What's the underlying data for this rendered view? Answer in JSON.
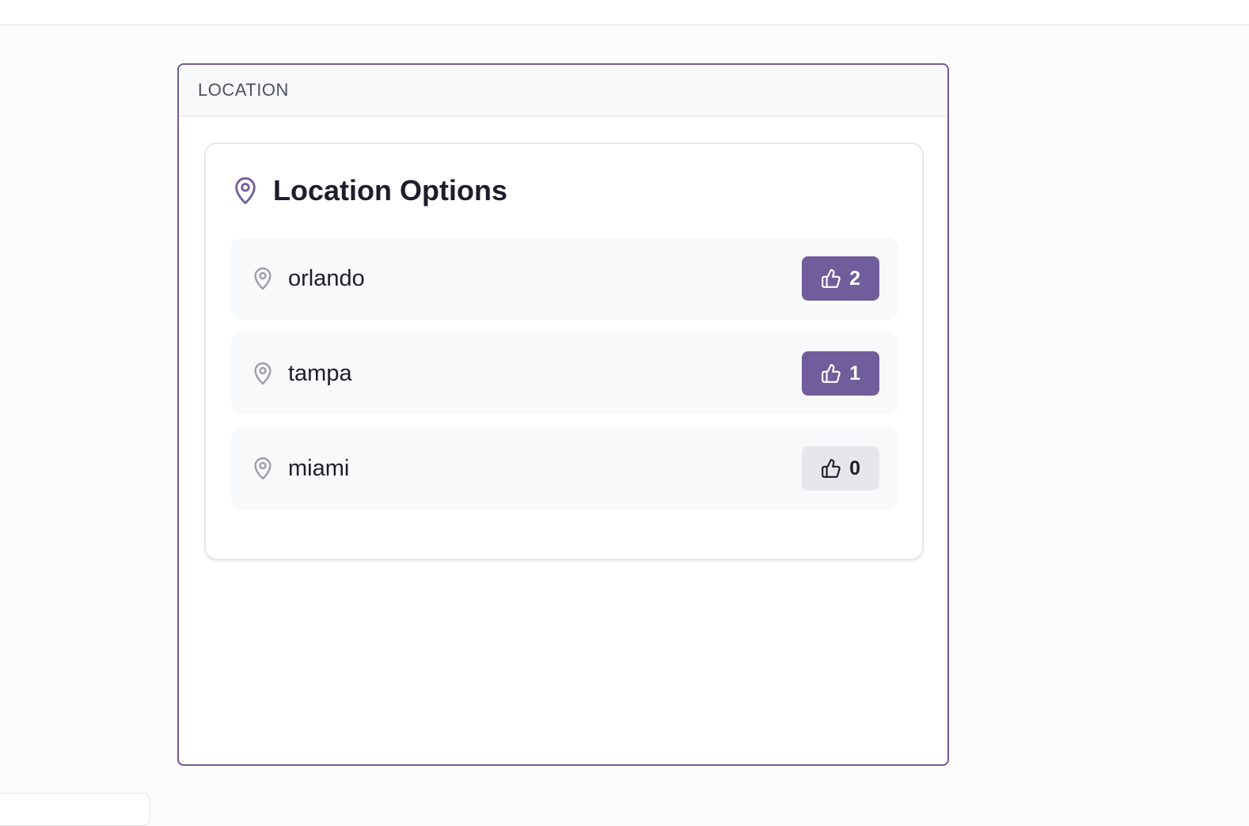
{
  "panel": {
    "header_title": "LOCATION"
  },
  "card": {
    "title": "Location Options",
    "title_icon": "map-pin-icon"
  },
  "options": [
    {
      "label": "orlando",
      "votes": "2",
      "voted": true
    },
    {
      "label": "tampa",
      "votes": "1",
      "voted": true
    },
    {
      "label": "miami",
      "votes": "0",
      "voted": false
    }
  ],
  "colors": {
    "accent": "#715d9b",
    "panel_border": "#6e5a96",
    "inactive_button": "#e6e7ea",
    "option_background": "#f8f9fb"
  },
  "icons": {
    "option_icon": "map-pin-icon",
    "vote_icon": "thumbs-up-icon"
  }
}
